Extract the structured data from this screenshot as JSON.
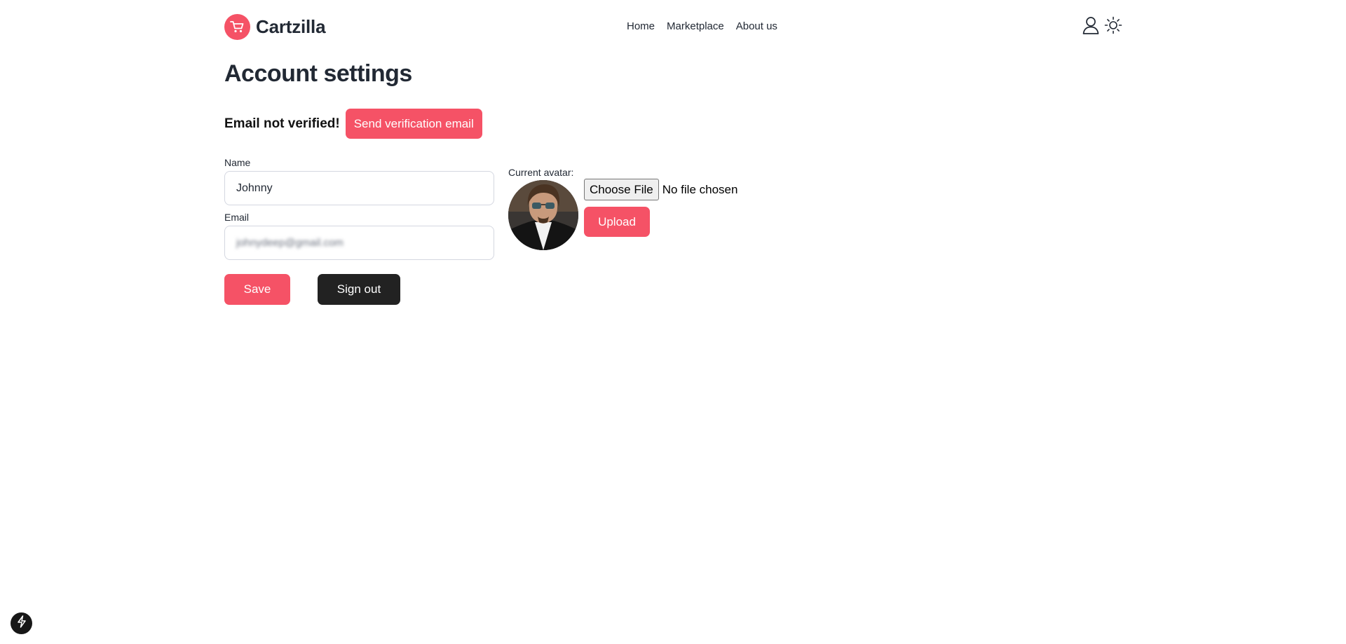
{
  "brand": {
    "name": "Cartzilla",
    "accent_color": "#f55266"
  },
  "nav": {
    "items": [
      {
        "label": "Home"
      },
      {
        "label": "Marketplace"
      },
      {
        "label": "About us"
      }
    ]
  },
  "header_icons": {
    "account": "user-icon",
    "theme": "sun-icon"
  },
  "page": {
    "title": "Account settings"
  },
  "verification": {
    "message": "Email not verified!",
    "button_label": "Send verification email"
  },
  "form": {
    "name_label": "Name",
    "name_value": "Johnny",
    "email_label": "Email",
    "email_value": "johnydeep@gmail.com",
    "save_label": "Save",
    "signout_label": "Sign out"
  },
  "avatar": {
    "label": "Current avatar:",
    "choose_label": "Choose File",
    "file_status": "No file chosen",
    "upload_label": "Upload"
  },
  "dev_badge": {
    "icon": "lightning-icon"
  }
}
